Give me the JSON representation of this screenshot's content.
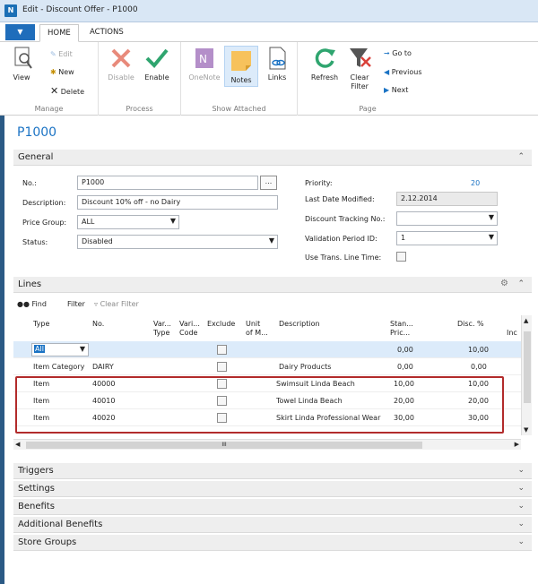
{
  "window": {
    "title": "Edit - Discount Offer - P1000",
    "app_icon": "navision-logo-icon"
  },
  "ribbon_tabs": {
    "file_label": "▼",
    "home": "HOME",
    "actions": "ACTIONS"
  },
  "ribbon": {
    "manage": {
      "label": "Manage",
      "view": "View",
      "edit": "Edit",
      "new": "New",
      "delete": "Delete"
    },
    "process": {
      "label": "Process",
      "disable": "Disable",
      "enable": "Enable"
    },
    "show_attached": {
      "label": "Show Attached",
      "onenote": "OneNote",
      "notes": "Notes",
      "links": "Links"
    },
    "page": {
      "label": "Page",
      "refresh": "Refresh",
      "clear_filter_1": "Clear",
      "clear_filter_2": "Filter",
      "go_to": "Go to",
      "previous": "Previous",
      "next": "Next"
    }
  },
  "page_title": "P1000",
  "general": {
    "title": "General",
    "no_label": "No.:",
    "no_value": "P1000",
    "assist": "...",
    "description_label": "Description:",
    "description_value": "Discount 10% off - no Dairy",
    "price_group_label": "Price Group:",
    "price_group_value": "ALL",
    "status_label": "Status:",
    "status_value": "Disabled",
    "priority_label": "Priority:",
    "priority_value": "20",
    "last_modified_label": "Last Date Modified:",
    "last_modified_value": "2.12.2014",
    "tracking_label": "Discount Tracking No.:",
    "tracking_value": "",
    "validation_label": "Validation Period ID:",
    "validation_value": "1",
    "use_trans_label": "Use Trans. Line Time:"
  },
  "lines": {
    "title": "Lines",
    "find": "Find",
    "filter": "Filter",
    "clear_filter": "Clear Filter",
    "headers": {
      "type": "Type",
      "no": "No.",
      "var_type_1": "Var...",
      "var_type_2": "Type",
      "var_code_1": "Vari...",
      "var_code_2": "Code",
      "exclude": "Exclude",
      "unit_1": "Unit",
      "unit_2": "of M...",
      "description": "Description",
      "standard_1": "Stan...",
      "standard_2": "Pric...",
      "disc": "Disc. %",
      "inc": "Inc"
    },
    "rows": [
      {
        "type": "All",
        "no": "",
        "description": "",
        "price": "0,00",
        "disc": "10,00"
      },
      {
        "type": "Item Category",
        "no": "DAIRY",
        "description": "Dairy Products",
        "price": "0,00",
        "disc": "0,00"
      },
      {
        "type": "Item",
        "no": "40000",
        "description": "Swimsuit Linda Beach",
        "price": "10,00",
        "disc": "10,00"
      },
      {
        "type": "Item",
        "no": "40010",
        "description": "Towel Linda Beach",
        "price": "20,00",
        "disc": "20,00"
      },
      {
        "type": "Item",
        "no": "40020",
        "description": "Skirt Linda Professional Wear",
        "price": "30,00",
        "disc": "30,00"
      }
    ],
    "scroll_thumb": "III"
  },
  "fasttabs": {
    "triggers": "Triggers",
    "settings": "Settings",
    "benefits": "Benefits",
    "additional": "Additional Benefits",
    "store_groups": "Store Groups"
  },
  "colors": {
    "accent": "#1b73c4",
    "highlight_box": "#b22b2b"
  }
}
